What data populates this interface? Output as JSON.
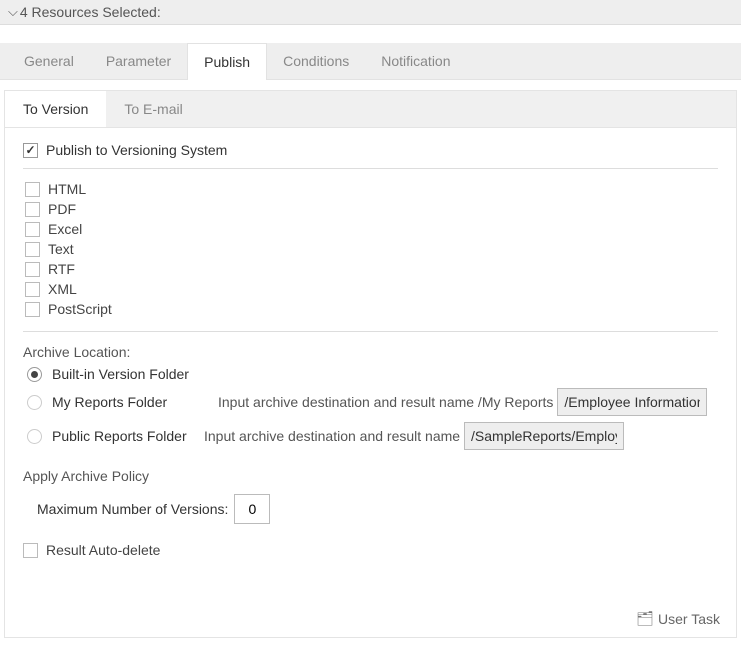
{
  "header": {
    "title": "4 Resources Selected:"
  },
  "tabs": {
    "general": "General",
    "parameter": "Parameter",
    "publish": "Publish",
    "conditions": "Conditions",
    "notification": "Notification"
  },
  "subtabs": {
    "toVersion": "To Version",
    "toEmail": "To E-mail"
  },
  "publishCheckbox": "Publish to Versioning System",
  "formats": [
    "HTML",
    "PDF",
    "Excel",
    "Text",
    "RTF",
    "XML",
    "PostScript"
  ],
  "archive": {
    "sectionLabel": "Archive Location:",
    "builtIn": "Built-in Version Folder",
    "myReports": "My Reports Folder",
    "publicReports": "Public Reports Folder",
    "destLabel1": "Input archive destination and result name /My Reports",
    "destValue1": "/Employee Information L",
    "destLabel2": "Input archive destination and result name",
    "destValue2": "/SampleReports/Employ"
  },
  "policy": {
    "heading": "Apply Archive Policy",
    "maxLabel": "Maximum Number of Versions:",
    "maxValue": "0"
  },
  "autoDelete": "Result Auto-delete",
  "footer": {
    "userTask": "User Task"
  }
}
